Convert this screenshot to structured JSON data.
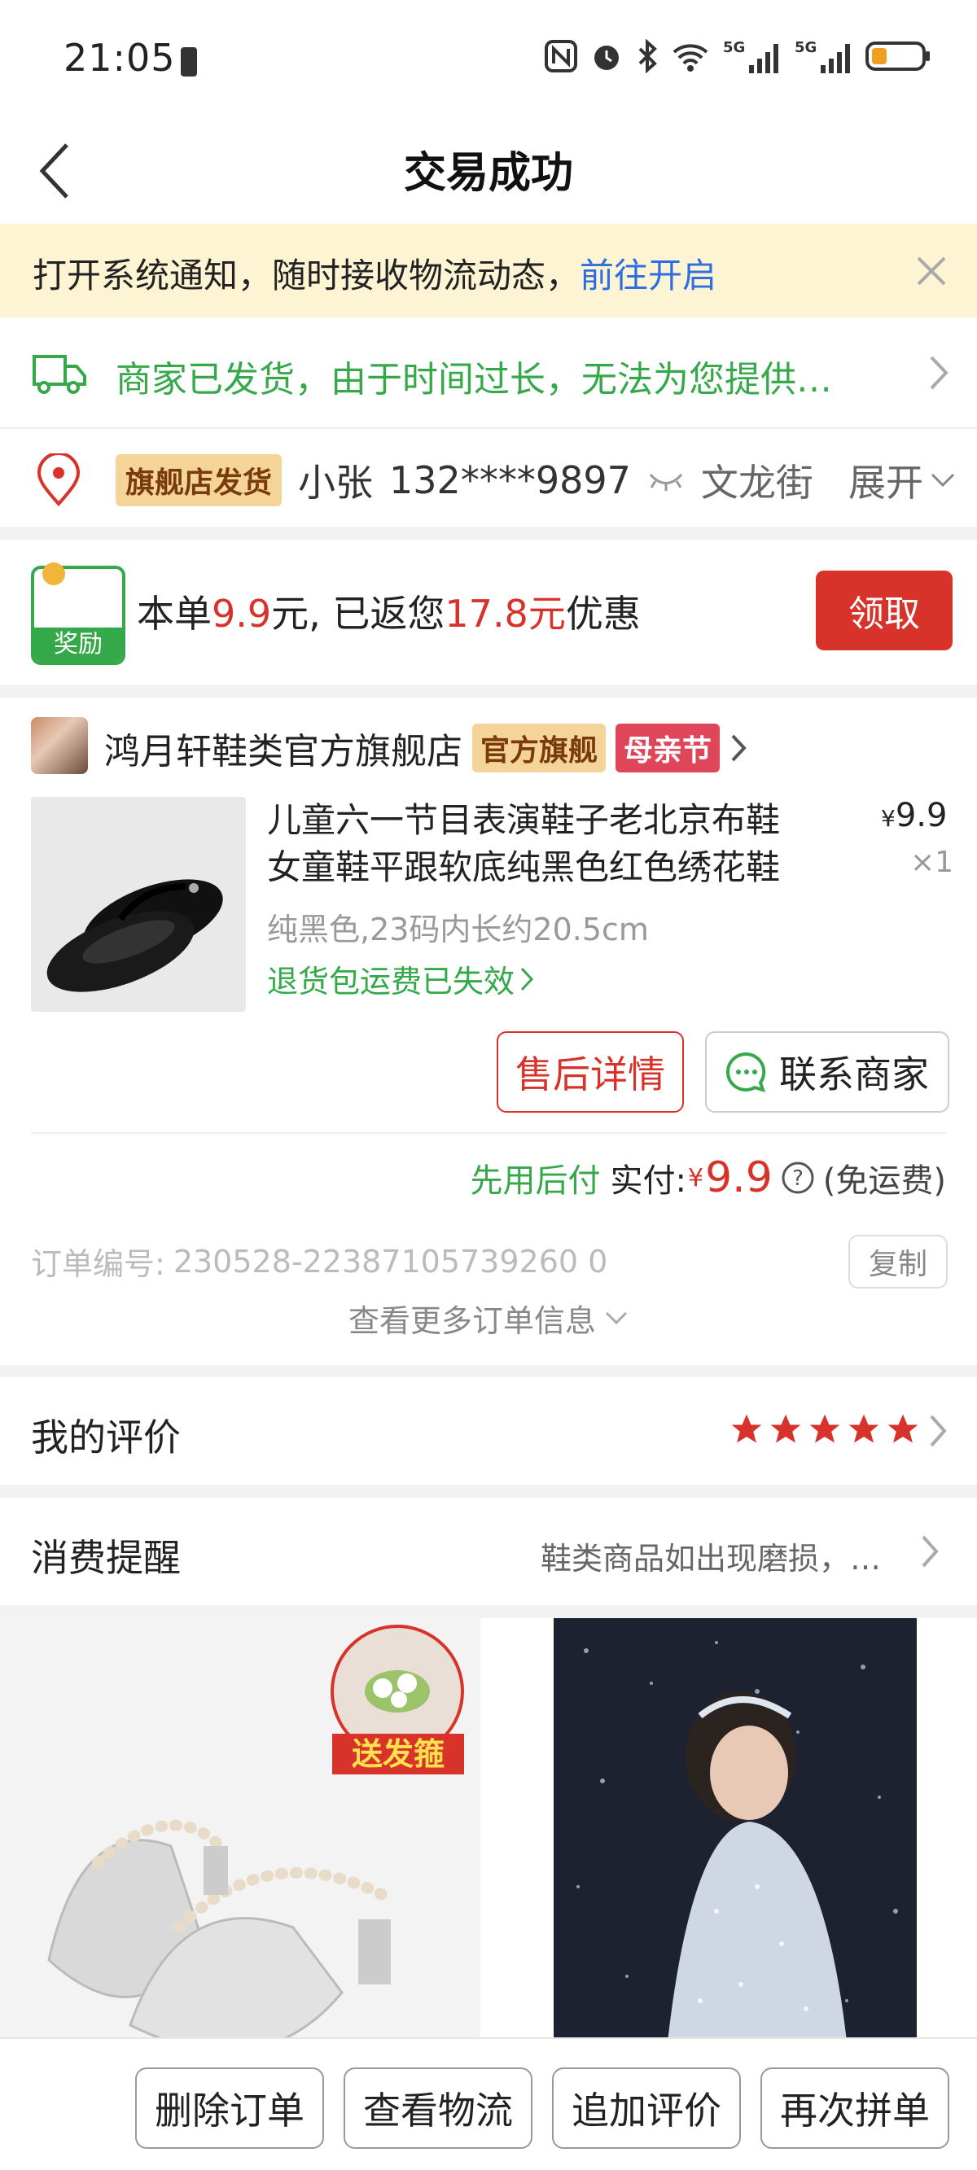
{
  "status_bar": {
    "time": "21:05",
    "network": "5G"
  },
  "nav": {
    "title": "交易成功"
  },
  "notice": {
    "text": "打开系统通知，随时接收物流动态，",
    "link": "前往开启"
  },
  "shipping": {
    "text": "商家已发货，由于时间过长，无法为您提供…"
  },
  "address": {
    "tag": "旗舰店发货",
    "name": "小张",
    "phone": "132****9897",
    "street": "文龙街",
    "expand": "展开"
  },
  "reward": {
    "badge": "奖励",
    "text_prefix": "本单",
    "amount": "9.9",
    "text_mid": "元, 已返您",
    "refund": "17.8元",
    "text_suffix": "优惠",
    "claim_label": "领取"
  },
  "store": {
    "name": "鸿月轩鞋类官方旗舰店",
    "badge_official": "官方旗舰",
    "badge_event": "母亲节",
    "product": {
      "title_line1": "儿童六一节目表演鞋子老北京布鞋",
      "title_line2": "女童鞋平跟软底纯黑色红色绣花鞋",
      "spec": "纯黑色,23码内长约20.5cm",
      "return_note": "退货包运费已失效",
      "price_symbol": "¥",
      "price": "9.9",
      "qty": "×1"
    },
    "after_sale_label": "售后详情",
    "contact_label": "联系商家",
    "pay_later": "先用后付",
    "paid_label": "实付:",
    "paid_symbol": "¥",
    "paid_amount": "9.9",
    "shipping_note": "(免运费)",
    "order_no_label": "订单编号:",
    "order_no": "230528-22387105739260 0",
    "copy_label": "复制",
    "more_info": "查看更多订单信息"
  },
  "evaluation": {
    "label": "我的评价",
    "stars": 5
  },
  "reminder": {
    "label": "消费提醒",
    "text": "鞋类商品如出现磨损，…"
  },
  "recommend": {
    "promo_tag": "送发箍"
  },
  "bottom": {
    "delete": "删除订单",
    "logistics": "查看物流",
    "add_review": "追加评价",
    "reorder": "再次拼单"
  },
  "colors": {
    "accent_red": "#d7332a",
    "green": "#35a94a",
    "link_blue": "#2f6ee0",
    "notice_bg": "#fdf4d3"
  }
}
